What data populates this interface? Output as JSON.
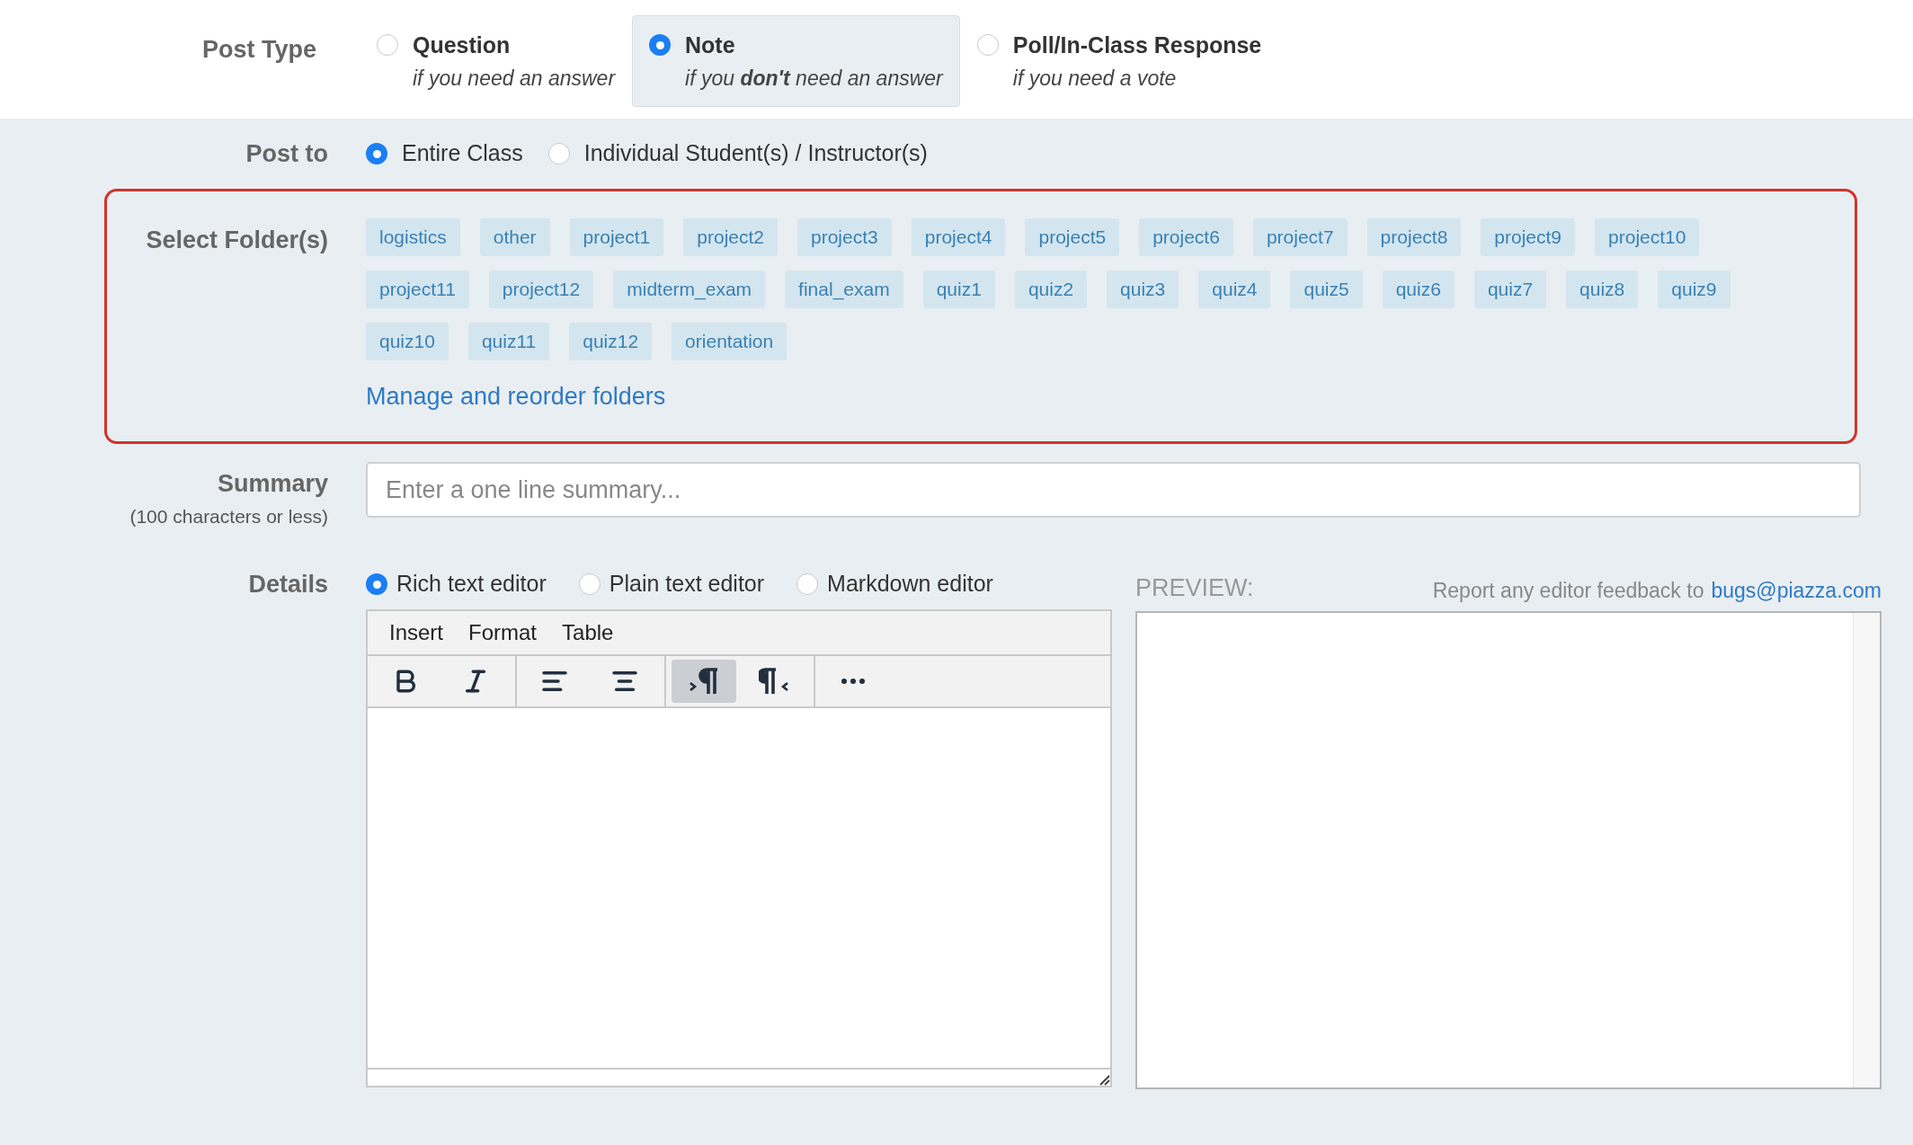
{
  "post_type": {
    "label": "Post Type",
    "options": [
      {
        "title": "Question",
        "description": "if you need an answer",
        "selected": false
      },
      {
        "title": "Note",
        "description": "if you **don't** need an answer",
        "selected": true
      },
      {
        "title": "Poll/In-Class Response",
        "description": "if you need a vote",
        "selected": false
      }
    ]
  },
  "post_to": {
    "label": "Post to",
    "options": [
      {
        "label": "Entire Class",
        "selected": true
      },
      {
        "label": "Individual Student(s) / Instructor(s)",
        "selected": false
      }
    ]
  },
  "folders": {
    "label": "Select Folder(s)",
    "tags": [
      "logistics",
      "other",
      "project1",
      "project2",
      "project3",
      "project4",
      "project5",
      "project6",
      "project7",
      "project8",
      "project9",
      "project10",
      "project11",
      "project12",
      "midterm_exam",
      "final_exam",
      "quiz1",
      "quiz2",
      "quiz3",
      "quiz4",
      "quiz5",
      "quiz6",
      "quiz7",
      "quiz8",
      "quiz9",
      "quiz10",
      "quiz11",
      "quiz12",
      "orientation"
    ],
    "manage_link": "Manage and reorder folders"
  },
  "summary": {
    "label": "Summary",
    "hint": "(100 characters or less)",
    "placeholder": "Enter a one line summary..."
  },
  "details": {
    "label": "Details",
    "editors": [
      {
        "label": "Rich text editor",
        "selected": true
      },
      {
        "label": "Plain text editor",
        "selected": false
      },
      {
        "label": "Markdown editor",
        "selected": false
      }
    ],
    "menu": [
      "Insert",
      "Format",
      "Table"
    ],
    "toolbar": [
      {
        "kind": "bold",
        "active": false
      },
      {
        "kind": "italic",
        "active": false
      },
      {
        "kind": "align-left",
        "active": false
      },
      {
        "kind": "align-center",
        "active": false
      },
      {
        "kind": "ltr",
        "active": true
      },
      {
        "kind": "rtl",
        "active": false
      },
      {
        "kind": "more",
        "active": false
      }
    ],
    "preview_label": "PREVIEW:",
    "feedback_text": "Report any editor feedback to",
    "feedback_link": "bugs@piazza.com"
  }
}
